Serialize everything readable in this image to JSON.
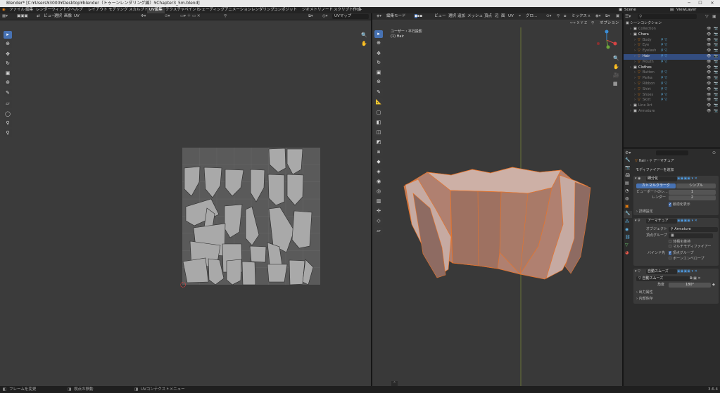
{
  "titlebar": {
    "title": "Blender* [C:¥Users¥3000¥Desktop¥blender（トゥーンレンダリング編）¥Chapter3_5m.blend]"
  },
  "menu": [
    "ファイル",
    "編集",
    "レンダー",
    "ウィンドウ",
    "ヘルプ"
  ],
  "workspaces": [
    "レイアウト",
    "モデリング",
    "スカルプト",
    "UV編集",
    "テクスチャペイント",
    "シェーディング",
    "アニメーション",
    "レンダリング",
    "コンポジット",
    "ジオメトリノード",
    "スクリプト作成"
  ],
  "workspace_add": "+",
  "scene": "Scene",
  "viewlayer": "ViewLayer",
  "uv_header": {
    "menus": [
      "ビュー",
      "選択",
      "画像",
      "UV"
    ],
    "uvmap": "UVマップ"
  },
  "vp_header": {
    "mode": "編集モード",
    "menus": [
      "ビュー",
      "選択",
      "追加",
      "メッシュ",
      "頂点",
      "辺",
      "面",
      "UV"
    ],
    "transform": "グロ...",
    "mix": "ミックス",
    "options": "オプション"
  },
  "vp_overlay": {
    "line1": "ユーザー・平行投影",
    "line2": "(1) Hair"
  },
  "outliner": {
    "search_placeholder": "",
    "root": "シーンコレクション",
    "rows": [
      {
        "label": "Collection",
        "dim": true,
        "indent": 1
      },
      {
        "label": "Chara",
        "dim": false,
        "indent": 1
      },
      {
        "label": "Body",
        "dim": true,
        "indent": 2
      },
      {
        "label": "Eye",
        "dim": true,
        "indent": 2
      },
      {
        "label": "Eyelash",
        "dim": true,
        "indent": 2
      },
      {
        "label": "Hair",
        "dim": false,
        "indent": 2,
        "selected": true
      },
      {
        "label": "Mouth",
        "dim": true,
        "indent": 2
      },
      {
        "label": "Clothes",
        "dim": false,
        "indent": 1
      },
      {
        "label": "Button",
        "dim": true,
        "indent": 2
      },
      {
        "label": "Parka",
        "dim": true,
        "indent": 2
      },
      {
        "label": "Ribbon",
        "dim": true,
        "indent": 2
      },
      {
        "label": "Shirt",
        "dim": true,
        "indent": 2
      },
      {
        "label": "Shoes",
        "dim": true,
        "indent": 2
      },
      {
        "label": "Skirt",
        "dim": true,
        "indent": 2
      },
      {
        "label": "Line Art",
        "dim": true,
        "indent": 1
      },
      {
        "label": "Armature",
        "dim": true,
        "indent": 1
      }
    ]
  },
  "properties": {
    "breadcrumb_obj": "Hair",
    "breadcrumb_sep": "›",
    "breadcrumb_mod": "アーマチュア",
    "add_modifier": "モディファイアーを追加",
    "subdiv": {
      "name": "細分化",
      "tab1": "カトマルクラーク",
      "tab2": "シンプル",
      "vp_label": "ビューポートのレ...",
      "vp_val": "1",
      "render_label": "レンダー",
      "render_val": "2",
      "optimal": "最適化表示",
      "advanced": "詳細設定"
    },
    "armature": {
      "name": "アーマチュア",
      "obj_label": "オブジェクト",
      "obj_val": "Armature",
      "vg_label": "頂点グループ",
      "preserve": "体積を維持",
      "multi": "マルチモディファイアー",
      "bind_label": "バインド先",
      "bind_vg": "頂点グループ",
      "bind_env": "ボーンエンベロープ"
    },
    "autosmooth": {
      "name": "自動スムーズ",
      "field": "自動スムーズ",
      "angle_label": "角度",
      "angle_val": "180°",
      "output": "出力属性",
      "internal": "内部依存"
    }
  },
  "status": {
    "left": "フレームを変更",
    "mid": "視点の移動",
    "right": "UVコンテクストメニュー",
    "version": "3.6.4"
  },
  "colors": {
    "accent": "#4772b3",
    "selection": "#334d80",
    "mesh_edge": "#e8742a"
  }
}
